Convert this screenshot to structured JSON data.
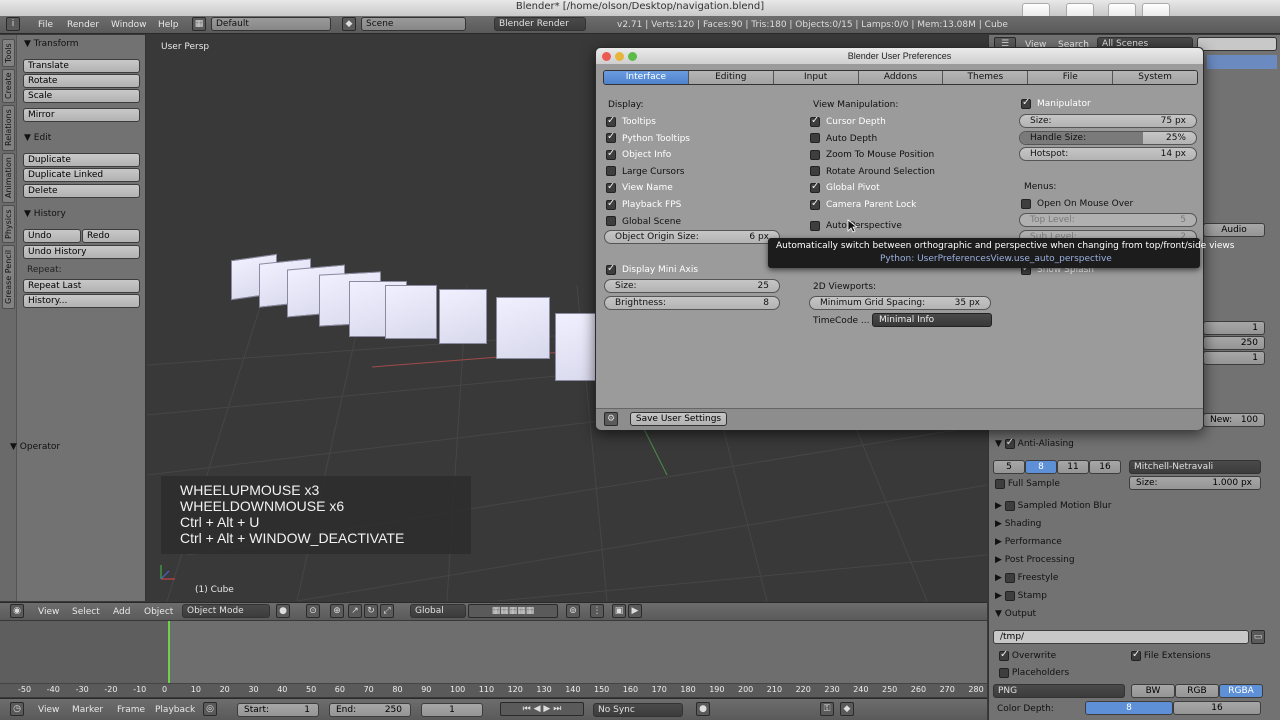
{
  "window": {
    "title": "Blender* [/home/olson/Desktop/navigation.blend]"
  },
  "menu": {
    "file": "File",
    "render": "Render",
    "window": "Window",
    "help": "Help"
  },
  "header": {
    "layout": "Default",
    "scene": "Scene",
    "engine": "Blender Render",
    "stats": "v2.71 | Verts:120 | Faces:90 | Tris:180 | Objects:0/15 | Lamps:0/0 | Mem:13.08M | Cube"
  },
  "toolshelf": {
    "tabs": [
      "Tools",
      "Create",
      "Relations",
      "Animation",
      "Physics",
      "Grease Pencil"
    ],
    "transform": {
      "title": "Transform",
      "translate": "Translate",
      "rotate": "Rotate",
      "scale": "Scale",
      "mirror": "Mirror"
    },
    "edit": {
      "title": "Edit",
      "duplicate": "Duplicate",
      "duplicate_linked": "Duplicate Linked",
      "delete": "Delete"
    },
    "history": {
      "title": "History",
      "undo": "Undo",
      "redo": "Redo",
      "undo_history": "Undo History",
      "repeat_label": "Repeat:",
      "repeat_last": "Repeat Last",
      "history_btn": "History..."
    },
    "operator": "Operator"
  },
  "viewport": {
    "label": "User Persp",
    "object_label": "(1) Cube",
    "key_overlay": [
      "WHEELUPMOUSE x3",
      "WHEELDOWNMOUSE x6",
      "Ctrl + Alt + U",
      "Ctrl + Alt + WINDOW_DEACTIVATE"
    ]
  },
  "view_header": {
    "view": "View",
    "select": "Select",
    "add": "Add",
    "object": "Object",
    "mode": "Object Mode",
    "orientation": "Global"
  },
  "timeline": {
    "ticks": [
      "-50",
      "-40",
      "-30",
      "-20",
      "-10",
      "0",
      "10",
      "20",
      "30",
      "40",
      "50",
      "60",
      "70",
      "80",
      "90",
      "100",
      "110",
      "120",
      "130",
      "140",
      "150",
      "160",
      "170",
      "180",
      "190",
      "200",
      "210",
      "220",
      "230",
      "240",
      "250",
      "260",
      "270",
      "280"
    ],
    "view": "View",
    "marker": "Marker",
    "frame": "Frame",
    "playback": "Playback",
    "start_label": "Start:",
    "start": "1",
    "end_label": "End:",
    "end": "250",
    "current": "1",
    "sync": "No Sync"
  },
  "outliner": {
    "view": "View",
    "search": "Search",
    "scenes": "All Scenes"
  },
  "properties": {
    "audio": "Audio",
    "res_vals": [
      "1",
      "250",
      "1"
    ],
    "new_label": "New:",
    "new_val": "100",
    "anti_aliasing": "Anti-Aliasing",
    "aa_samples": [
      "5",
      "8",
      "11",
      "16"
    ],
    "filter": "Mitchell-Netravali",
    "full_sample": "Full Sample",
    "size_label": "Size:",
    "size_val": "1.000 px",
    "sampled_motion_blur": "Sampled Motion Blur",
    "shading": "Shading",
    "performance": "Performance",
    "post_processing": "Post Processing",
    "freestyle": "Freestyle",
    "stamp": "Stamp",
    "output": "Output",
    "output_path": "/tmp/",
    "overwrite": "Overwrite",
    "file_extensions": "File Extensions",
    "placeholders": "Placeholders",
    "format": "PNG",
    "bw": "BW",
    "rgb": "RGB",
    "rgba": "RGBA",
    "color_depth_label": "Color Depth:",
    "depth_8": "8",
    "depth_16": "16"
  },
  "prefs": {
    "title": "Blender User Preferences",
    "tabs": [
      "Interface",
      "Editing",
      "Input",
      "Addons",
      "Themes",
      "File",
      "System"
    ],
    "display": {
      "title": "Display:",
      "items": [
        {
          "label": "Tooltips",
          "on": true
        },
        {
          "label": "Python Tooltips",
          "on": true
        },
        {
          "label": "Object Info",
          "on": true
        },
        {
          "label": "Large Cursors",
          "on": false
        },
        {
          "label": "View Name",
          "on": true
        },
        {
          "label": "Playback FPS",
          "on": true
        },
        {
          "label": "Global Scene",
          "on": false
        }
      ],
      "origin_label": "Object Origin Size:",
      "origin_val": "6 px",
      "mini_axis": "Display Mini Axis",
      "size_label": "Size:",
      "size_val": "25",
      "bright_label": "Brightness:",
      "bright_val": "8"
    },
    "view_manip": {
      "title": "View Manipulation:",
      "items": [
        {
          "label": "Cursor Depth",
          "on": true
        },
        {
          "label": "Auto Depth",
          "on": false
        },
        {
          "label": "Zoom To Mouse Position",
          "on": false
        },
        {
          "label": "Rotate Around Selection",
          "on": false
        },
        {
          "label": "Global Pivot",
          "on": true
        },
        {
          "label": "Camera Parent Lock",
          "on": true
        }
      ],
      "auto_persp": "Auto Perspective",
      "viewports_2d": "2D Viewports:",
      "grid_label": "Minimum Grid Spacing:",
      "grid_val": "35 px",
      "timecode_label": "TimeCode ...",
      "timecode_val": "Minimal Info"
    },
    "manipulator": {
      "title": "Manipulator",
      "size_label": "Size:",
      "size_val": "75 px",
      "handle_label": "Handle Size:",
      "handle_val": "25%",
      "handle_fraction": 0.25,
      "hotspot_label": "Hotspot:",
      "hotspot_val": "14 px",
      "menus": "Menus:",
      "open_mouse": "Open On Mouse Over",
      "top_level_label": "Top Level:",
      "top_level_val": "5",
      "sub_level_label": "Sub Level:",
      "sub_level_val": "2",
      "show_splash": "Show Splash"
    },
    "save": "Save User Settings",
    "tooltip": {
      "line1": "Automatically switch between orthographic and perspective when changing from top/front/side views",
      "line2": "Python: UserPreferencesView.use_auto_perspective"
    }
  }
}
